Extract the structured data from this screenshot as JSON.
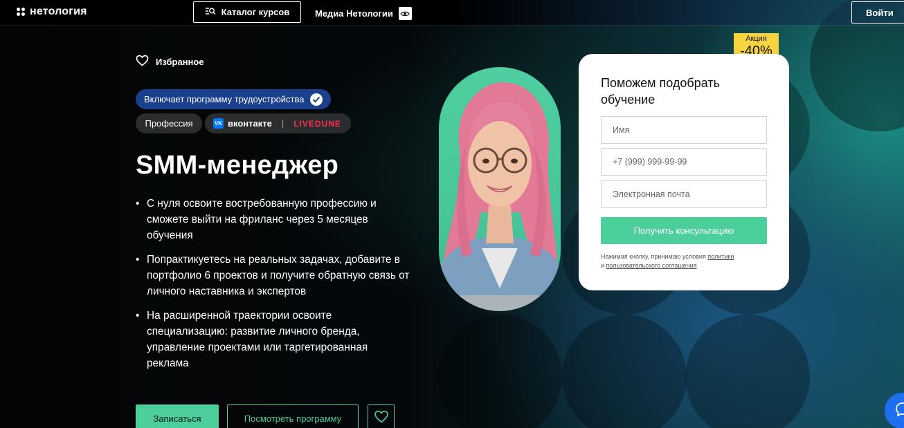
{
  "header": {
    "logo_text": "нетология",
    "catalog_label": "Каталог курсов",
    "media_label": "Медиа Нетологии",
    "login_label": "Войти"
  },
  "hero": {
    "favorites_label": "Избранное",
    "employment_badge": "Включает программу трудоустройства",
    "profession_pill": "Профессия",
    "partner_vk": "вконтакте",
    "partner_separator": "|",
    "partner_livedune": "LIVEDUNE",
    "title": "SMM-менеджер",
    "bullets": [
      "С нуля освоите востребованную профессию и сможете выйти на фриланс через 5 месяцев обучения",
      "Попрактикуетесь на реальных задачах, добавите в портфолио 6 проектов и получите обратную связь от личного наставника и экспертов",
      "На расширенной траектории освоите специализацию: развитие личного бренда, управление проектами или таргетированная реклама"
    ],
    "enroll_label": "Записаться",
    "program_label": "Посмотреть программу"
  },
  "sale": {
    "label": "Акция",
    "value": "-40%"
  },
  "form": {
    "title": "Поможем подобрать обучение",
    "name_placeholder": "Имя",
    "phone_placeholder": "+7 (999) 999-99-99",
    "email_placeholder": "Электронная почта",
    "submit_label": "Получить консультацию",
    "terms_prefix": "Нажимая кнопку, принимаю условия",
    "terms_policy": "политики",
    "terms_and": "и",
    "terms_agreement": "пользовательского соглашения"
  },
  "colors": {
    "accent_green": "#4ccf9b",
    "badge_blue": "#1a3f8c",
    "sale_yellow": "#f7d241",
    "livedune_red": "#ff2e4d",
    "chat_blue": "#1e6ef0"
  }
}
